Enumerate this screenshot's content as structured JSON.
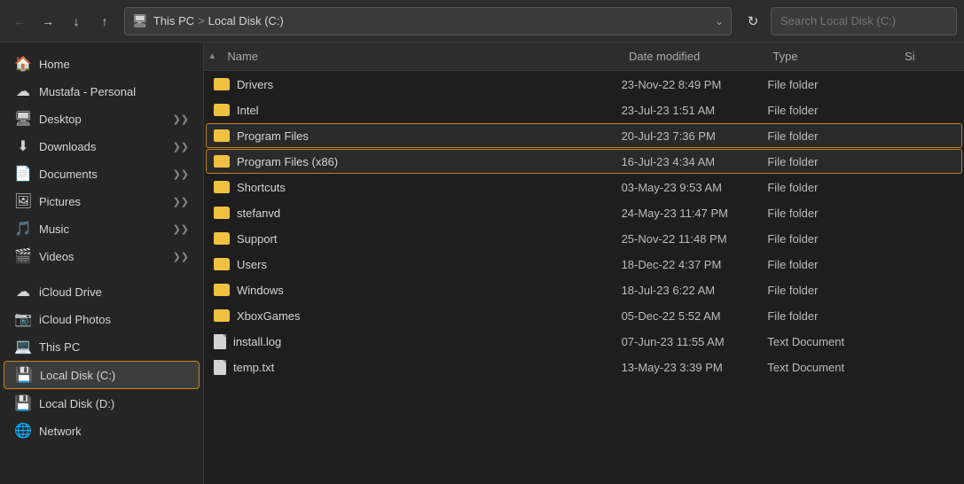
{
  "nav": {
    "back_btn": "←",
    "forward_btn": "→",
    "recent_btn": "↓",
    "up_btn": "↑",
    "address_icon": "🖥",
    "path_parts": [
      "This PC",
      "Local Disk (C:)"
    ],
    "path_sep": ">",
    "refresh_btn": "↻",
    "search_placeholder": "Search Local Disk (C:)"
  },
  "sidebar": {
    "items": [
      {
        "id": "home",
        "label": "Home",
        "icon": "🏠",
        "pinned": false
      },
      {
        "id": "onedrive",
        "label": "Mustafa - Personal",
        "icon": "☁",
        "pinned": false
      },
      {
        "id": "desktop",
        "label": "Desktop",
        "icon": "🖥",
        "pinned": true
      },
      {
        "id": "downloads",
        "label": "Downloads",
        "icon": "⬇",
        "pinned": true
      },
      {
        "id": "documents",
        "label": "Documents",
        "icon": "📄",
        "pinned": true
      },
      {
        "id": "pictures",
        "label": "Pictures",
        "icon": "🖼",
        "pinned": true
      },
      {
        "id": "music",
        "label": "Music",
        "icon": "🎵",
        "pinned": true
      },
      {
        "id": "videos",
        "label": "Videos",
        "icon": "🎬",
        "pinned": true
      },
      {
        "id": "icloud-drive",
        "label": "iCloud Drive",
        "icon": "☁",
        "pinned": false
      },
      {
        "id": "icloud-photos",
        "label": "iCloud Photos",
        "icon": "📷",
        "pinned": false
      },
      {
        "id": "this-pc",
        "label": "This PC",
        "icon": "💻",
        "pinned": false
      },
      {
        "id": "local-disk-c",
        "label": "Local Disk (C:)",
        "icon": "💾",
        "pinned": false,
        "active": true
      },
      {
        "id": "local-disk-d",
        "label": "Local Disk (D:)",
        "icon": "💾",
        "pinned": false
      },
      {
        "id": "network",
        "label": "Network",
        "icon": "🌐",
        "pinned": false
      }
    ]
  },
  "columns": {
    "name": "Name",
    "date_modified": "Date modified",
    "type": "Type",
    "size": "Si"
  },
  "files": [
    {
      "name": "Drivers",
      "date": "23-Nov-22 8:49 PM",
      "type": "File folder",
      "size": "",
      "is_folder": true,
      "highlighted": false
    },
    {
      "name": "Intel",
      "date": "23-Jul-23 1:51 AM",
      "type": "File folder",
      "size": "",
      "is_folder": true,
      "highlighted": false
    },
    {
      "name": "Program Files",
      "date": "20-Jul-23 7:36 PM",
      "type": "File folder",
      "size": "",
      "is_folder": true,
      "highlighted": true
    },
    {
      "name": "Program Files (x86)",
      "date": "16-Jul-23 4:34 AM",
      "type": "File folder",
      "size": "",
      "is_folder": true,
      "highlighted": true
    },
    {
      "name": "Shortcuts",
      "date": "03-May-23 9:53 AM",
      "type": "File folder",
      "size": "",
      "is_folder": true,
      "highlighted": false
    },
    {
      "name": "stefanvd",
      "date": "24-May-23 11:47 PM",
      "type": "File folder",
      "size": "",
      "is_folder": true,
      "highlighted": false
    },
    {
      "name": "Support",
      "date": "25-Nov-22 11:48 PM",
      "type": "File folder",
      "size": "",
      "is_folder": true,
      "highlighted": false
    },
    {
      "name": "Users",
      "date": "18-Dec-22 4:37 PM",
      "type": "File folder",
      "size": "",
      "is_folder": true,
      "highlighted": false
    },
    {
      "name": "Windows",
      "date": "18-Jul-23 6:22 AM",
      "type": "File folder",
      "size": "",
      "is_folder": true,
      "highlighted": false
    },
    {
      "name": "XboxGames",
      "date": "05-Dec-22 5:52 AM",
      "type": "File folder",
      "size": "",
      "is_folder": true,
      "highlighted": false
    },
    {
      "name": "install.log",
      "date": "07-Jun-23 11:55 AM",
      "type": "Text Document",
      "size": "",
      "is_folder": false,
      "highlighted": false
    },
    {
      "name": "temp.txt",
      "date": "13-May-23 3:39 PM",
      "type": "Text Document",
      "size": "",
      "is_folder": false,
      "highlighted": false
    }
  ],
  "colors": {
    "accent": "#c8821a",
    "background": "#1e1e1e",
    "sidebar_bg": "#252525",
    "header_bg": "#2d2d2d",
    "active_item_border": "#c8821a"
  }
}
